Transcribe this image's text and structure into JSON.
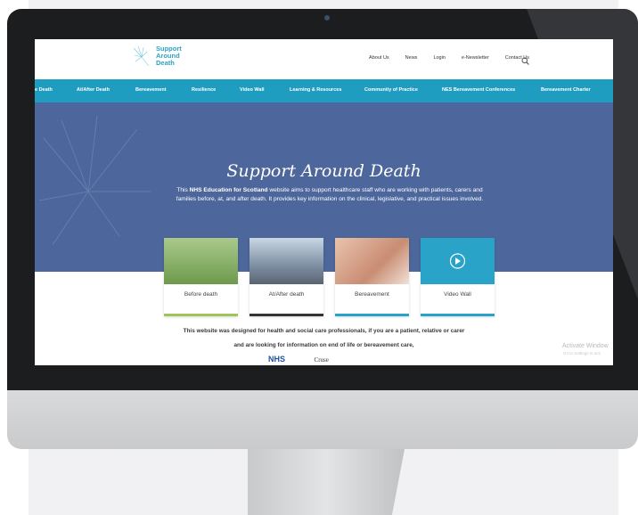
{
  "site": {
    "logo_lines": [
      "Support",
      "Around",
      "Death"
    ],
    "top_nav": [
      "About Us",
      "News",
      "Login",
      "e-Newsletter",
      "Contact Us"
    ],
    "main_nav": [
      "e Death",
      "At/After Death",
      "Bereavement",
      "Resilience",
      "Video Wall",
      "Learning & Resources",
      "Community of Practice",
      "NES Bereavement Conferences",
      "Bereavement Charter"
    ],
    "hero_title": "Support Around Death",
    "hero_text_pre": "This ",
    "hero_text_bold": "NHS Education for Scotland",
    "hero_text_post": " website aims to support healthcare staff who are working with patients, carers and families before, at, and after death. It provides key information on the clinical, legislative, and practical issues involved.",
    "cards": [
      {
        "label": "Before death",
        "color": "#9fc45a"
      },
      {
        "label": "At/After death",
        "color": "#333333"
      },
      {
        "label": "Bereavement",
        "color": "#2aa3c8"
      },
      {
        "label": "Video Wall",
        "color": "#2aa3c8"
      }
    ],
    "tagline_1": "This website was designed for health and social care professionals, if you are a patient, relative or carer",
    "tagline_2": "and are looking for information on end of life or bereavement care,",
    "partner_1": "NHS",
    "partner_2": "Cruse"
  },
  "os": {
    "activate_title": "Activate Window",
    "activate_sub": "Go to Settings to acti"
  },
  "colors": {
    "teal": "#1e9dc1",
    "hero": "#4d679c"
  }
}
